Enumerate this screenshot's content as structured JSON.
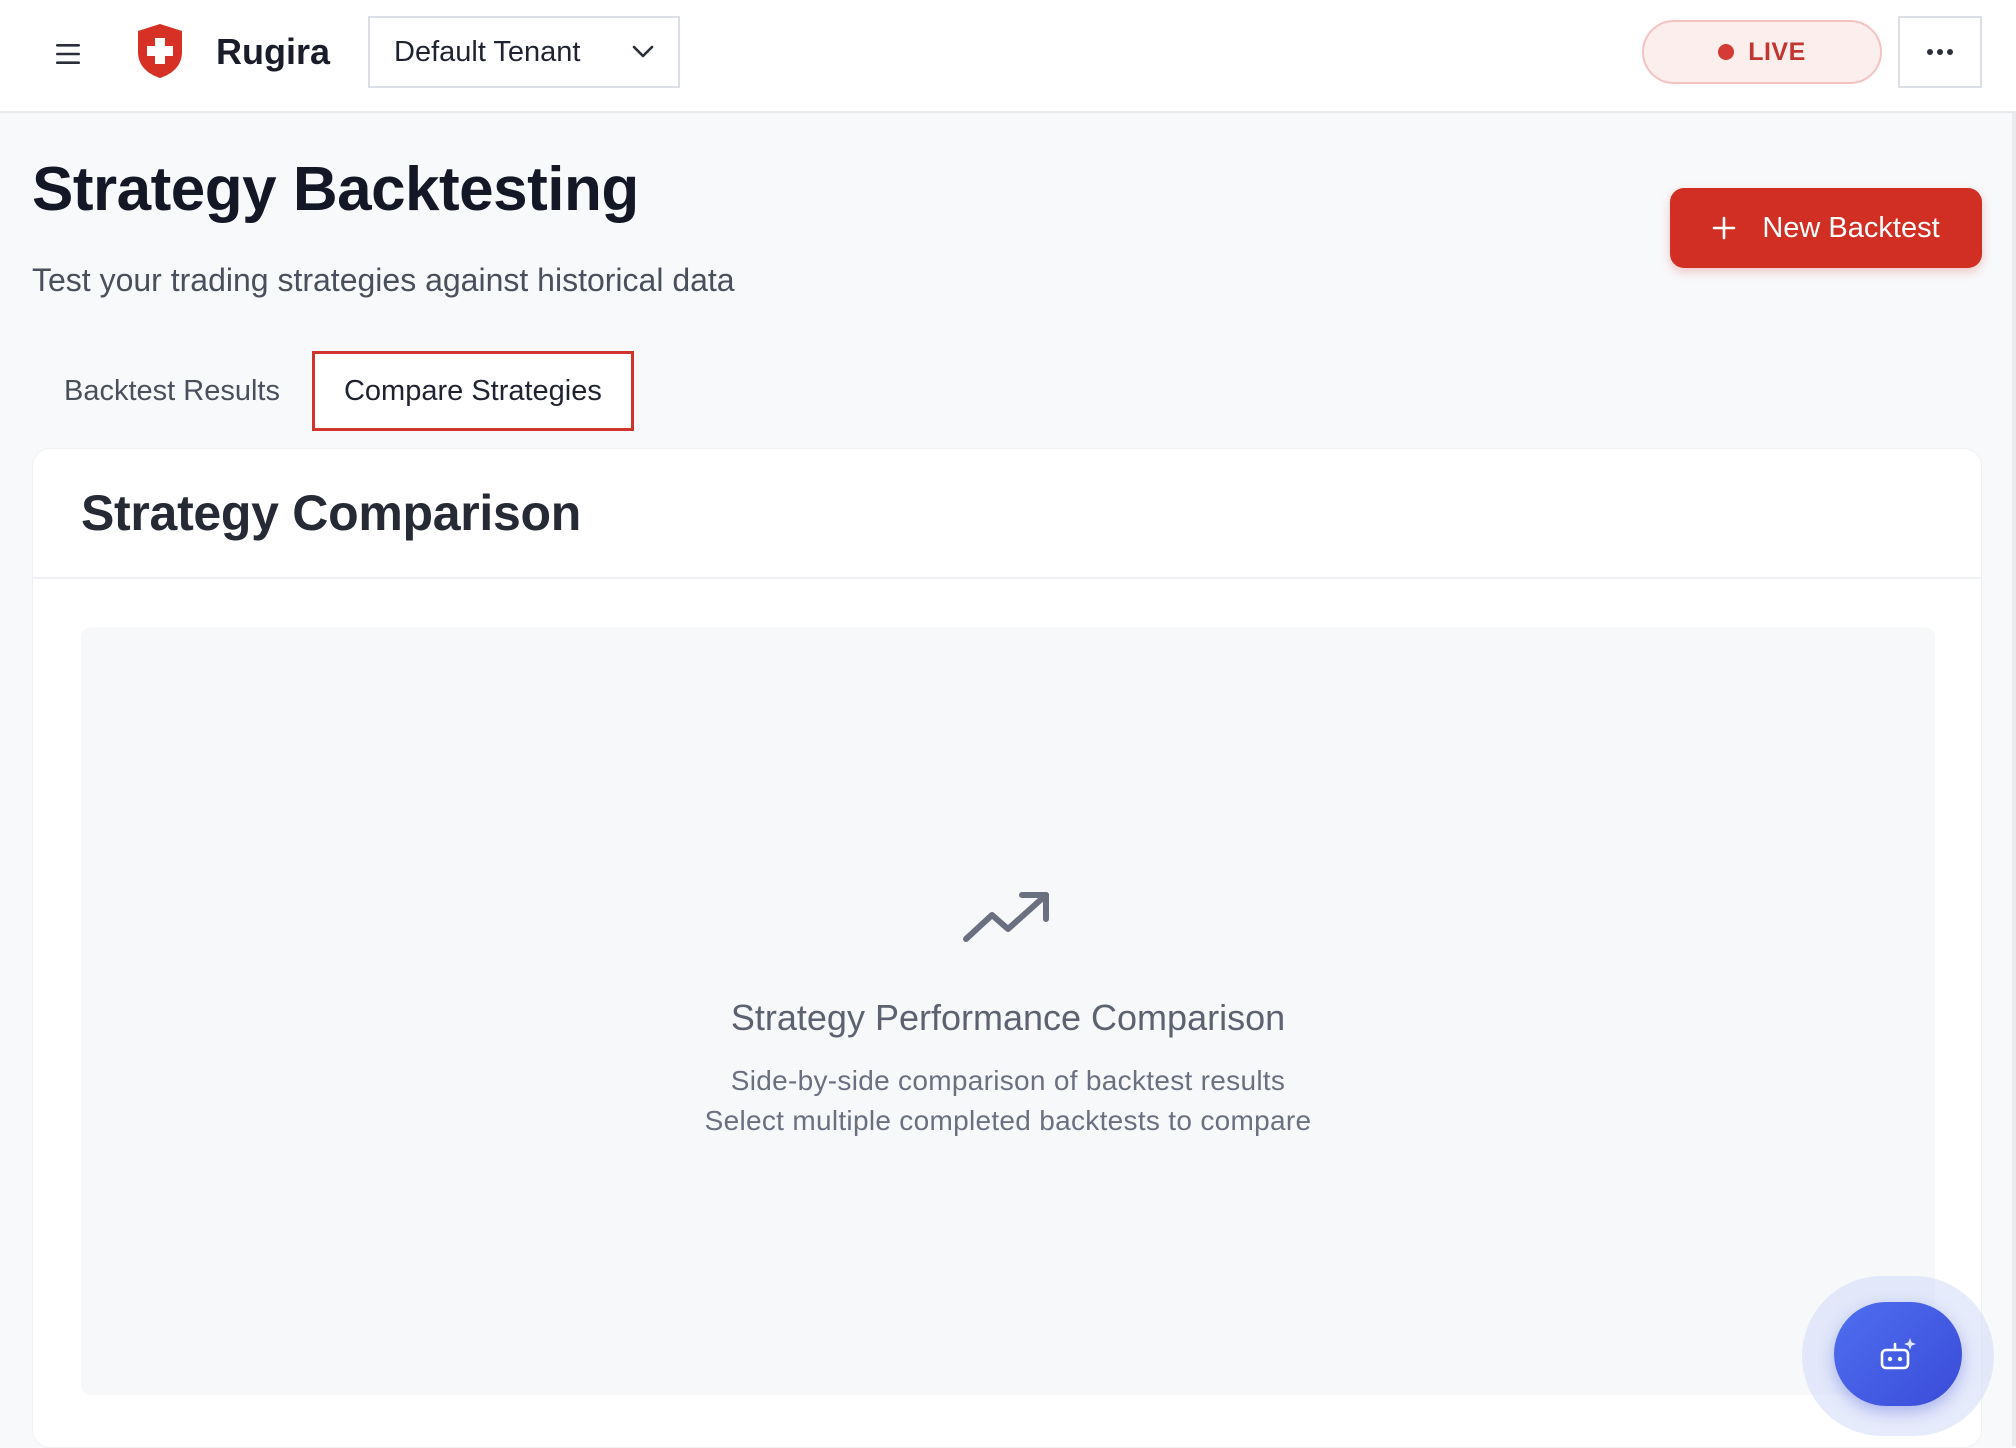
{
  "topbar": {
    "app_name": "Rugira",
    "tenant": {
      "selected": "Default Tenant"
    },
    "status": {
      "label": "LIVE",
      "color": "#d63a36"
    },
    "brand_color": "#d22f24",
    "icons": [
      "hamburger-menu-icon",
      "shield-logo-icon",
      "chevron-down-icon",
      "status-dot-icon",
      "more-horizontal-icon"
    ]
  },
  "page": {
    "title": "Strategy Backtesting",
    "subtitle": "Test your trading strategies against historical data",
    "new_button_label": "New Backtest",
    "new_button_icon": "plus-icon"
  },
  "tabs": [
    {
      "label": "Backtest Results",
      "active": false
    },
    {
      "label": "Compare Strategies",
      "active": true
    }
  ],
  "comparison": {
    "card_title": "Strategy Comparison",
    "empty_icon": "trending-up-icon",
    "empty_title": "Strategy Performance Comparison",
    "empty_line1": "Side-by-side comparison of backtest results",
    "empty_line2": "Select multiple completed backtests to compare"
  },
  "assistant": {
    "icon": "ai-assistant-bot-icon",
    "accent": "#3a4bd8"
  }
}
